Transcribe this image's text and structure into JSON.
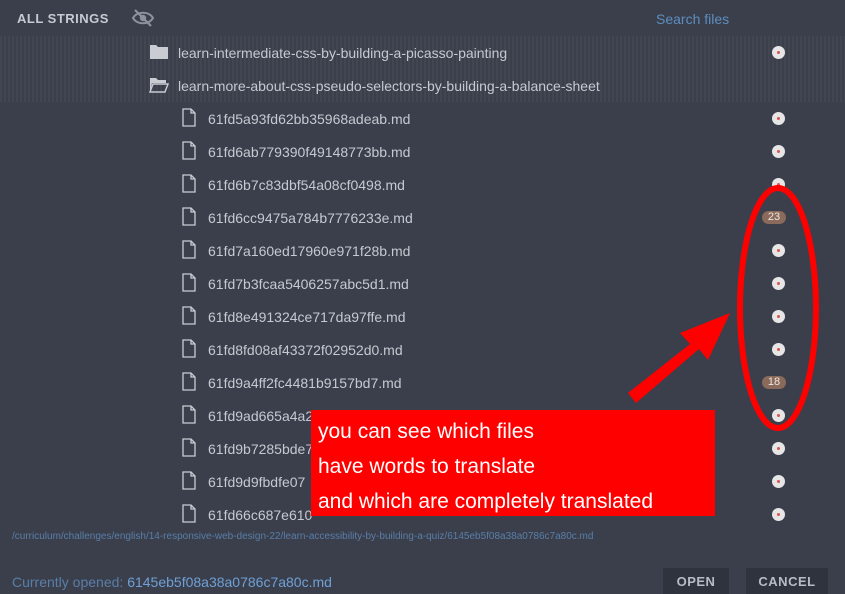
{
  "header": {
    "title": "ALL STRINGS",
    "search_placeholder": "Search files"
  },
  "folders": [
    {
      "label": "learn-intermediate-css-by-building-a-picasso-painting",
      "open": false
    },
    {
      "label": "learn-more-about-css-pseudo-selectors-by-building-a-balance-sheet",
      "open": true
    }
  ],
  "files": [
    {
      "label": "61fd5a93fd62bb35968adeab.md",
      "status": "done"
    },
    {
      "label": "61fd6ab779390f49148773bb.md",
      "status": "done"
    },
    {
      "label": "61fd6b7c83dbf54a08cf0498.md",
      "status": "done"
    },
    {
      "label": "61fd6cc9475a784b7776233e.md",
      "status": "23"
    },
    {
      "label": "61fd7a160ed17960e971f28b.md",
      "status": "done"
    },
    {
      "label": "61fd7b3fcaa5406257abc5d1.md",
      "status": "done"
    },
    {
      "label": "61fd8e491324ce717da97ffe.md",
      "status": "done"
    },
    {
      "label": "61fd8fd08af43372f02952d0.md",
      "status": "done"
    },
    {
      "label": "61fd9a4ff2fc4481b9157bd7.md",
      "status": "18"
    },
    {
      "label": "61fd9ad665a4a2",
      "status": "done"
    },
    {
      "label": "61fd9b7285bde7",
      "status": "done"
    },
    {
      "label": "61fd9d9fbdfe07",
      "status": "done"
    },
    {
      "label": "61fd66c687e610",
      "status": "done"
    }
  ],
  "footer": {
    "path": "/curriculum/challenges/english/14-responsive-web-design-22/learn-accessibility-by-building-a-quiz/6145eb5f08a38a0786c7a80c.md",
    "opened_label": "Currently opened:",
    "opened_file": "6145eb5f08a38a0786c7a80c.md",
    "open_button": "OPEN",
    "cancel_button": "CANCEL"
  },
  "annotation": {
    "lines": [
      "you can see which files",
      "have words to translate",
      "and which are completely translated"
    ],
    "color": "#ff0000"
  }
}
